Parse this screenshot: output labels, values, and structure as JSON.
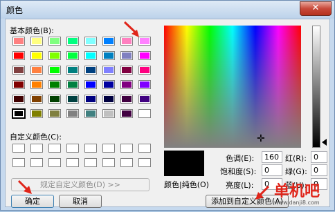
{
  "window": {
    "title": "颜色",
    "close_glyph": "✕"
  },
  "basic": {
    "label": "基本颜色(B):",
    "colors": [
      [
        "#ff8080",
        "#ffff80",
        "#80ff80",
        "#00ff80",
        "#80ffff",
        "#0080ff",
        "#ff80c0",
        "#ff80ff"
      ],
      [
        "#ff0000",
        "#ffff00",
        "#80ff00",
        "#00ff40",
        "#00ffff",
        "#0080c0",
        "#8080c0",
        "#ff00ff"
      ],
      [
        "#804040",
        "#ff8040",
        "#00ff00",
        "#008080",
        "#004080",
        "#8080ff",
        "#800040",
        "#ff0080"
      ],
      [
        "#800000",
        "#ff8000",
        "#008000",
        "#008040",
        "#0000ff",
        "#0000a0",
        "#800080",
        "#8000ff"
      ],
      [
        "#400000",
        "#804000",
        "#004000",
        "#004040",
        "#000080",
        "#000040",
        "#400040",
        "#400080"
      ],
      [
        "#000000",
        "#808000",
        "#808040",
        "#808080",
        "#408080",
        "#c0c0c0",
        "#400040",
        "#ffffff"
      ]
    ]
  },
  "custom": {
    "label": "自定义颜色(C):",
    "count": 16,
    "color": "#ffffff"
  },
  "buttons": {
    "define_custom": "规定自定义颜色(D) >>",
    "ok": "确定",
    "cancel": "取消",
    "add_custom": "添加到自定义颜色(A)"
  },
  "fields": {
    "hue_label": "色调(E):",
    "hue": "160",
    "sat_label": "饱和度(S):",
    "sat": "0",
    "lum_label": "亮度(L):",
    "lum": "0",
    "red_label": "红(R):",
    "red": "0",
    "green_label": "绿(G):",
    "green": "0",
    "blue_label": "蓝(U):",
    "blue": "0",
    "color_solid_label": "颜色|纯色(O)"
  },
  "watermark": {
    "text": "单机吧",
    "url": "www.danji8.com"
  },
  "colors": {
    "accent_red": "#e0251a",
    "frame_blue": "#c6d9ee"
  }
}
